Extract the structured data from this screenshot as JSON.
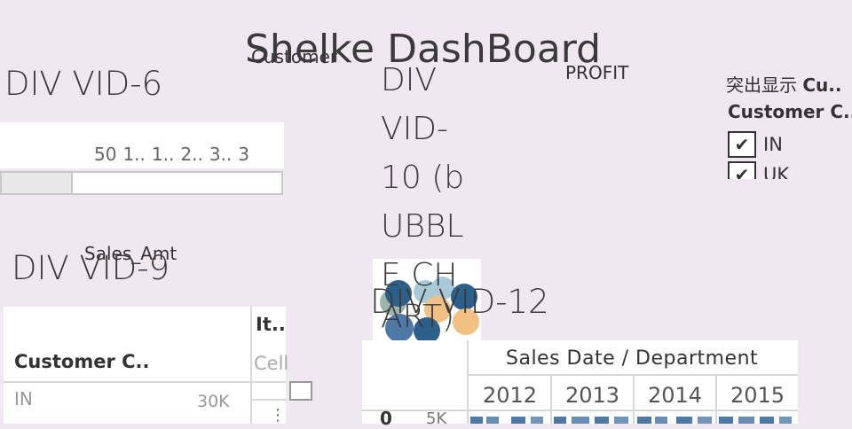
{
  "dashboard": {
    "title": "Shelke DashBoard",
    "overlap_customer": "Customer",
    "overlap_profit": "PROFIT",
    "overlap_sales_amt": "Sales_Amt"
  },
  "div6": {
    "heading": "DIV VID-6",
    "axis_ticks": [
      "50",
      "1..",
      "1..",
      "2..",
      "3..",
      "3"
    ]
  },
  "div9": {
    "heading": "DIV VID-9",
    "col_item": "It..",
    "col_customer": "Customer C..",
    "cell_label": "Cell",
    "row_label": "IN",
    "row_value": "30K",
    "more": "⋮"
  },
  "div10": {
    "heading_lines": [
      "DIV",
      "VID-",
      "10 (b",
      "UBBL",
      "E CH",
      "ART)"
    ]
  },
  "div12": {
    "heading": "DIV VID-12",
    "header": "Sales Date  /  Department",
    "years": [
      "2012",
      "2013",
      "2014",
      "2015"
    ],
    "axis_label": "0",
    "axis_tick": "5K"
  },
  "highlight": {
    "title_prefix": "突出显示",
    "title_field": "Cu..",
    "field_name": "Customer C..",
    "options": [
      {
        "label": "IN",
        "checked": true
      },
      {
        "label": "UK",
        "checked": true
      }
    ],
    "check_glyph": "✔"
  },
  "colors": {
    "background": "#f0e8f0",
    "bar": "#4e79a7",
    "bubble_dark": "#2c5f8a",
    "bubble_mid": "#4e79a7",
    "bubble_light": "#a9c8d8",
    "bubble_orange": "#f1c083",
    "bubble_grey": "#9fb4a8"
  }
}
